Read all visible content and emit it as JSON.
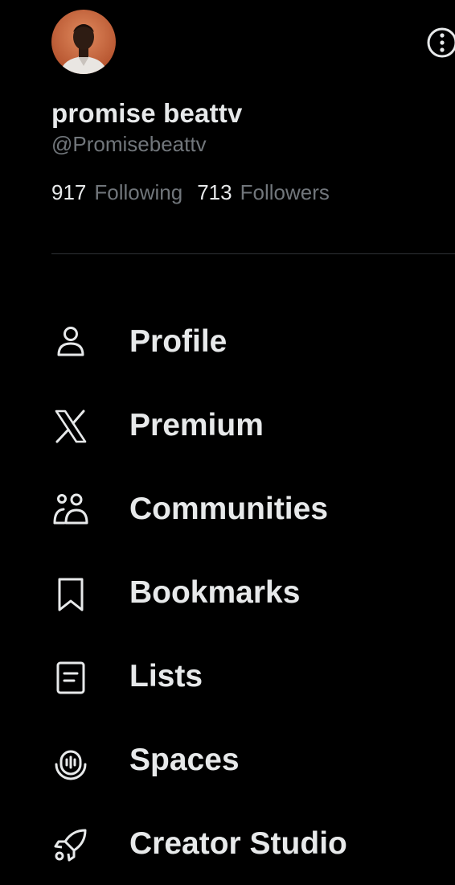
{
  "profile": {
    "display_name": "promise beattv",
    "handle": "@Promisebeattv",
    "following_count": "917",
    "following_label": "Following",
    "followers_count": "713",
    "followers_label": "Followers",
    "avatar_icon": "user-avatar-photo"
  },
  "header": {
    "more_icon": "more-options-icon"
  },
  "menu": {
    "items": [
      {
        "label": "Profile",
        "icon": "person-icon"
      },
      {
        "label": "Premium",
        "icon": "x-logo-icon"
      },
      {
        "label": "Communities",
        "icon": "communities-icon"
      },
      {
        "label": "Bookmarks",
        "icon": "bookmark-icon"
      },
      {
        "label": "Lists",
        "icon": "list-icon"
      },
      {
        "label": "Spaces",
        "icon": "spaces-microphone-icon"
      },
      {
        "label": "Creator Studio",
        "icon": "rocket-icon"
      }
    ]
  },
  "colors": {
    "background": "#000000",
    "primary_text": "#e7e9ea",
    "secondary_text": "#71767b",
    "divider": "#2f3336"
  }
}
